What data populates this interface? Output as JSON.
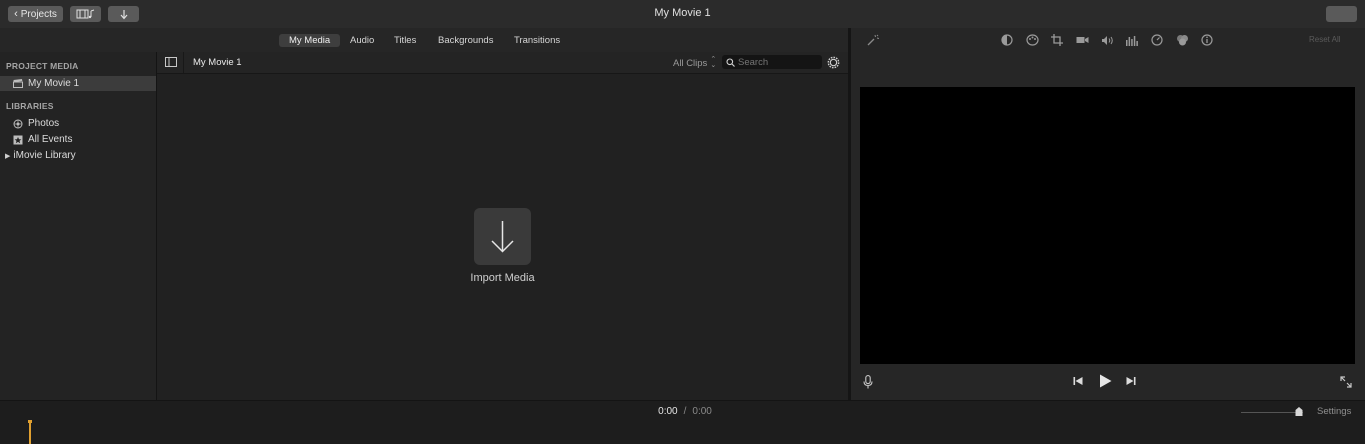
{
  "titlebar": {
    "projects_label": "Projects",
    "window_title": "My Movie 1"
  },
  "tabs": [
    {
      "label": "My Media",
      "active": true
    },
    {
      "label": "Audio",
      "active": false
    },
    {
      "label": "Titles",
      "active": false
    },
    {
      "label": "Backgrounds",
      "active": false
    },
    {
      "label": "Transitions",
      "active": false
    }
  ],
  "sidebar": {
    "project_media_heading": "PROJECT MEDIA",
    "project_item": "My Movie 1",
    "libraries_heading": "LIBRARIES",
    "photos": "Photos",
    "all_events": "All Events",
    "imovie_library": "iMovie Library"
  },
  "browser": {
    "title": "My Movie 1",
    "filter": "All Clips",
    "search_placeholder": "Search",
    "import_label": "Import Media"
  },
  "viewer": {
    "reset_all": "Reset All",
    "tool_icons": [
      "magic-wand-icon",
      "color-balance-icon",
      "color-correction-icon",
      "crop-icon",
      "stabilization-icon",
      "volume-icon",
      "equalizer-icon",
      "speed-icon",
      "clip-filter-icon",
      "info-icon"
    ]
  },
  "bottom": {
    "current_time": "0:00",
    "separator": "/",
    "total_time": "0:00",
    "settings": "Settings"
  },
  "colors": {
    "accent_playhead": "#e0a030",
    "selected_item_bg": "#3c3c3c",
    "viewer_bg": "#000000"
  }
}
